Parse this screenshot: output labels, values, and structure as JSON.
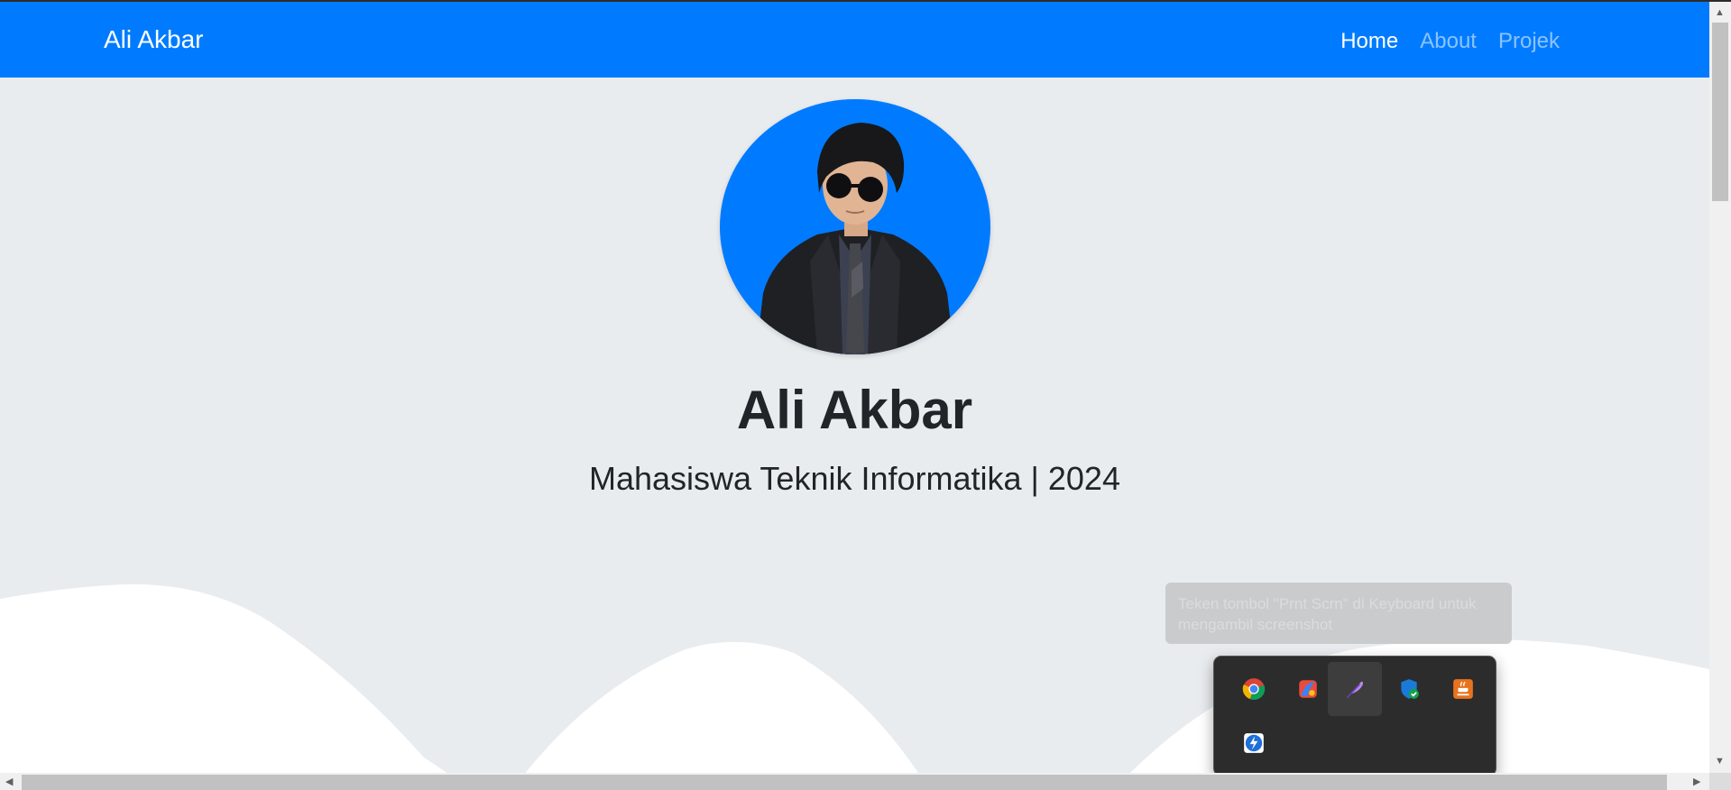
{
  "navbar": {
    "brand": "Ali Akbar",
    "links": [
      {
        "label": "Home",
        "active": true
      },
      {
        "label": "About",
        "active": false
      },
      {
        "label": "Projek",
        "active": false
      }
    ],
    "bg_color": "#007bff"
  },
  "hero": {
    "avatar_icon": "profile-photo",
    "name": "Ali Akbar",
    "subtitle": "Mahasiswa Teknik Informatika | 2024"
  },
  "tooltip": {
    "text": "Teken tombol \"Prnt Scrn\" di Keyboard untuk mengambil screenshot"
  },
  "tray": {
    "icons": [
      "chrome-icon",
      "color-app-icon",
      "feather-icon",
      "security-shield-icon",
      "java-icon",
      "lightning-app-icon"
    ]
  },
  "colors": {
    "accent": "#007bff",
    "background": "#e9ecef",
    "tray_bg": "#2c2c2c"
  }
}
